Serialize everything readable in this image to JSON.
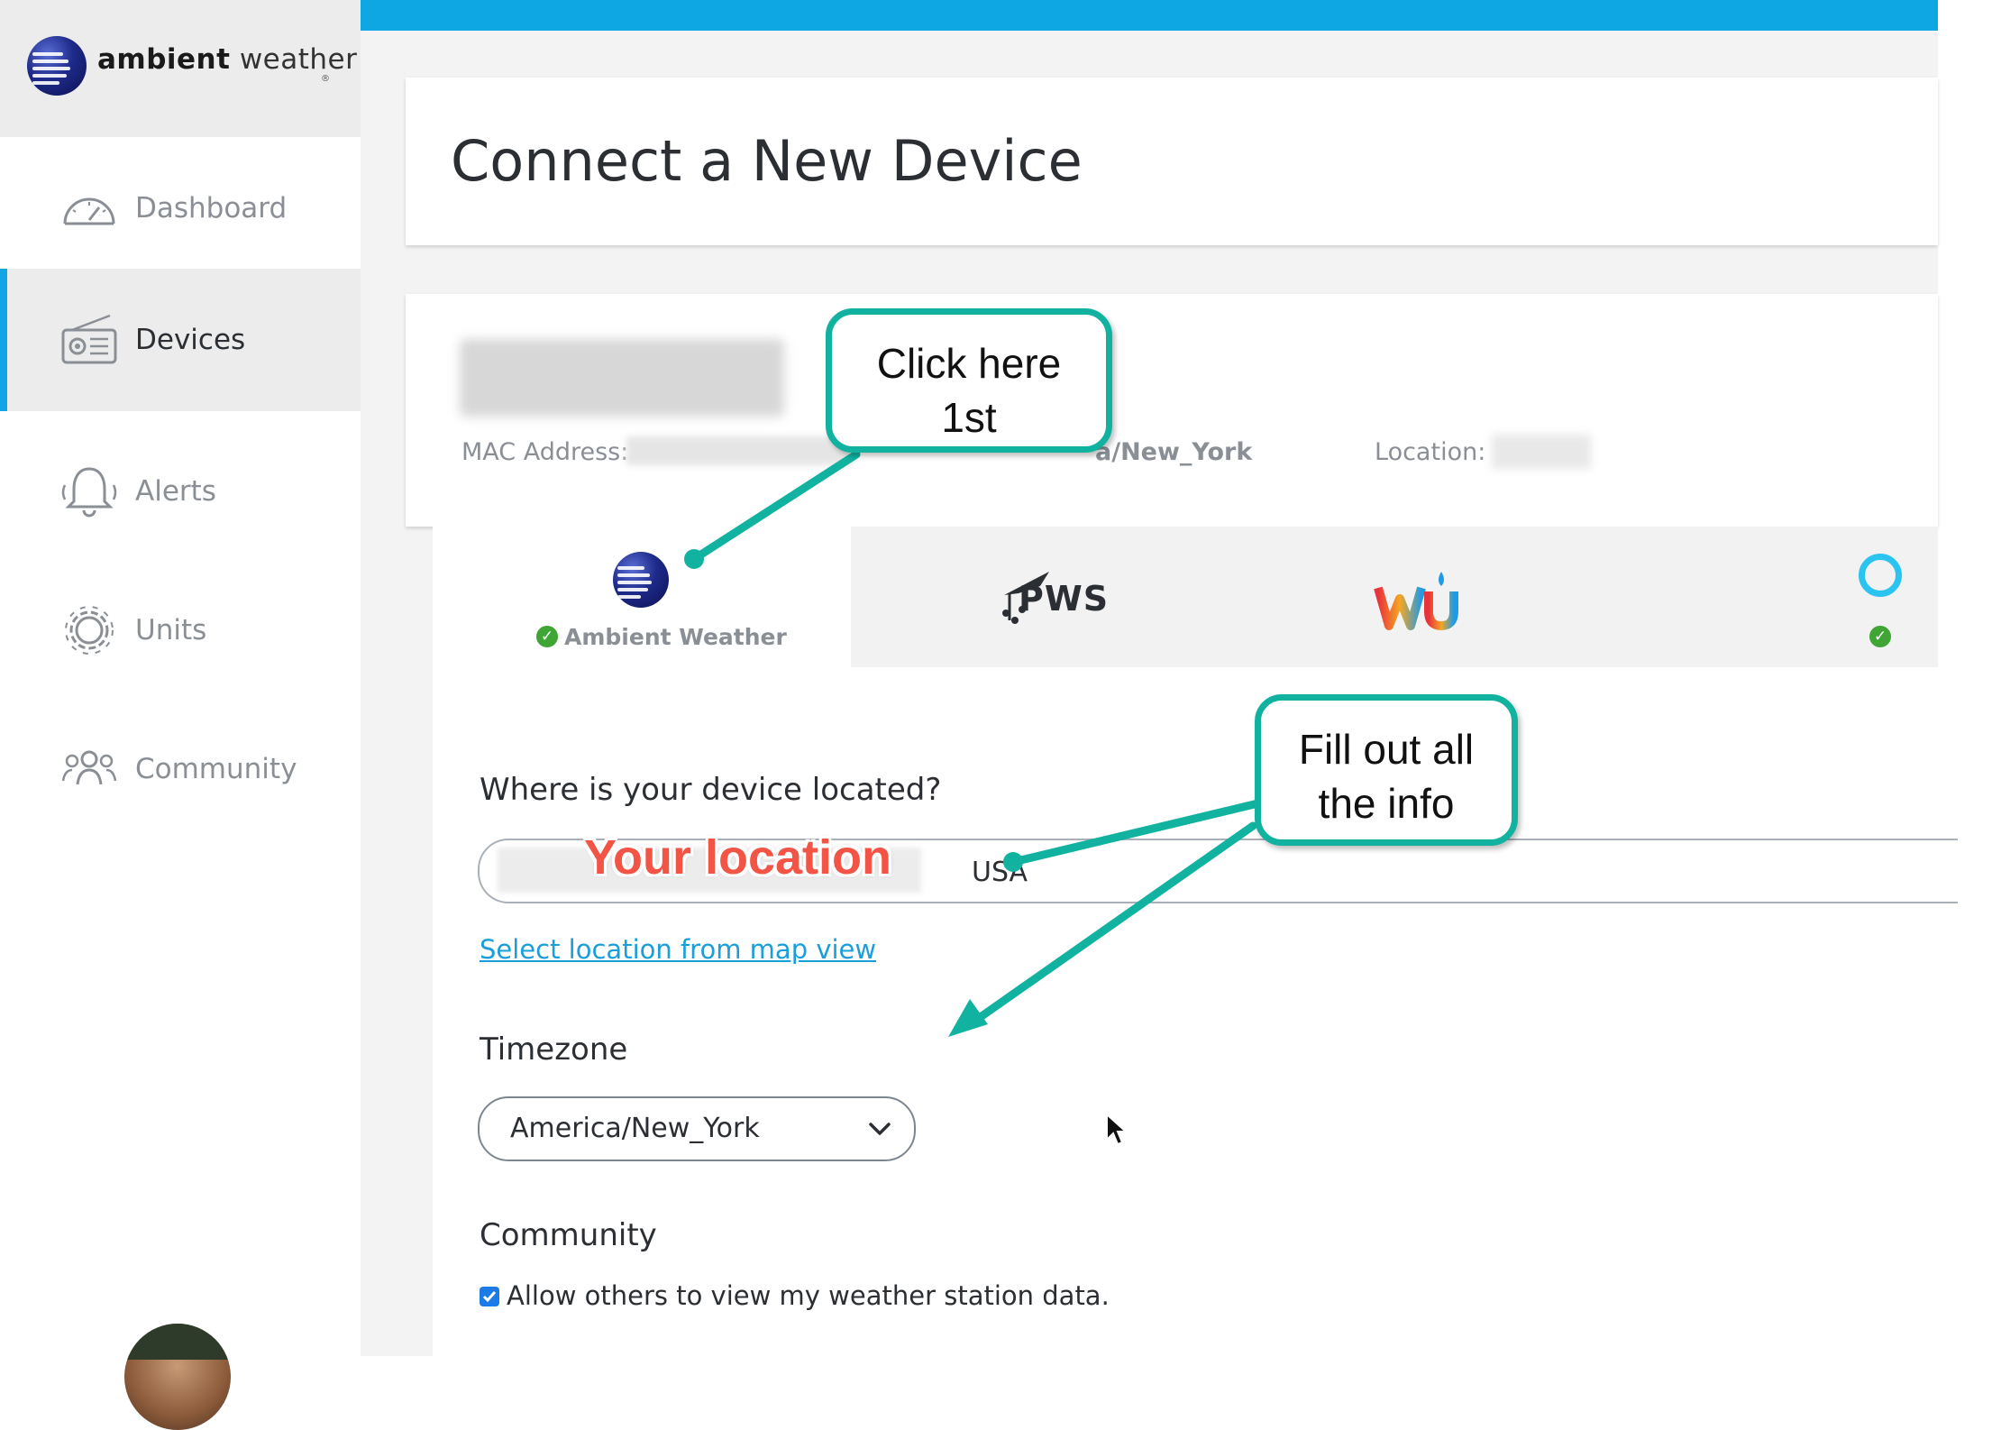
{
  "brand": {
    "bold": "ambient",
    "light": "weather",
    "reg": "®"
  },
  "sidebar": {
    "items": [
      {
        "label": "Dashboard",
        "icon": "gauge-icon",
        "active": false
      },
      {
        "label": "Devices",
        "icon": "radio-icon",
        "active": true
      },
      {
        "label": "Alerts",
        "icon": "bell-icon",
        "active": false
      },
      {
        "label": "Units",
        "icon": "gear-icon",
        "active": false
      },
      {
        "label": "Community",
        "icon": "people-icon",
        "active": false
      }
    ]
  },
  "page": {
    "title": "Connect a New Device"
  },
  "device": {
    "mac_label": "MAC Address:",
    "timezone_partial": "a/New_York",
    "location_label": "Location: "
  },
  "tabs": [
    {
      "label": "Ambient Weather",
      "icon": "ambient-globe-icon",
      "connected": true,
      "active": true
    },
    {
      "label": "PWS",
      "icon": "pws-icon",
      "connected": false,
      "active": false
    },
    {
      "label": "wu",
      "icon": "wunderground-icon",
      "connected": false,
      "active": false
    },
    {
      "label": "",
      "icon": "alexa-ring-icon",
      "connected": true,
      "active": false
    }
  ],
  "form": {
    "location_question": "Where is your device located?",
    "location_value": "USA",
    "map_link": "Select location from map view",
    "timezone_label": "Timezone",
    "timezone_value": "America/New_York",
    "community_label": "Community",
    "community_checkbox": "Allow others to view my weather station data.",
    "community_checked": true
  },
  "annotations": {
    "callout_1": [
      "Click here",
      "1st"
    ],
    "callout_2": [
      "Fill out all",
      "the info"
    ],
    "overlay_text": "Your location"
  },
  "colors": {
    "accent": "#0fa6e4",
    "callout_border": "#11b3a0",
    "link": "#1b9ed9",
    "check_green": "#3fa535",
    "overlay_red": "#f25546"
  }
}
